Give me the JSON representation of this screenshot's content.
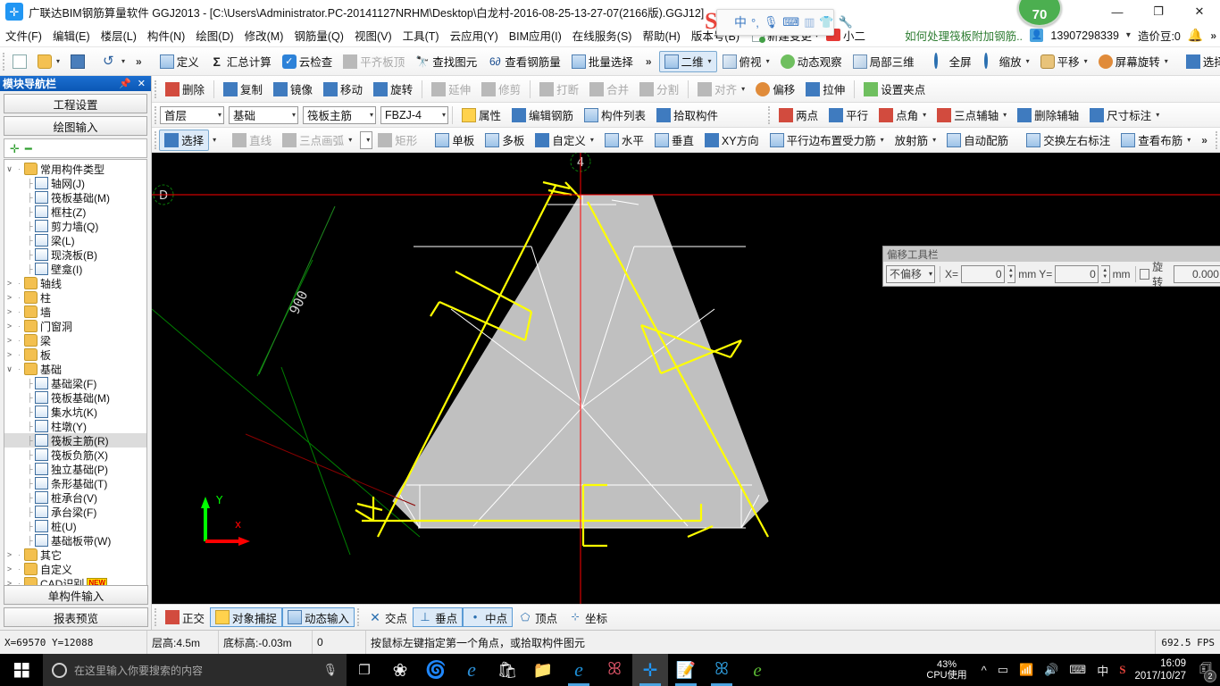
{
  "window": {
    "title": "广联达BIM钢筋算量软件 GGJ2013 - [C:\\Users\\Administrator.PC-20141127NRHM\\Desktop\\白龙村-2016-08-25-13-27-07(2166版).GGJ12]",
    "app_icon": "bim-app-icon",
    "minimize": "—",
    "maximize": "❐",
    "close": "✕",
    "score_badge": "70"
  },
  "menubar": {
    "items": [
      {
        "label": "文件(F)"
      },
      {
        "label": "编辑(E)"
      },
      {
        "label": "楼层(L)"
      },
      {
        "label": "构件(N)"
      },
      {
        "label": "绘图(D)"
      },
      {
        "label": "修改(M)"
      },
      {
        "label": "钢筋量(Q)"
      },
      {
        "label": "视图(V)"
      },
      {
        "label": "工具(T)"
      },
      {
        "label": "云应用(Y)"
      },
      {
        "label": "BIM应用(I)"
      },
      {
        "label": "在线服务(S)"
      },
      {
        "label": "帮助(H)"
      },
      {
        "label": "版本号(B)"
      }
    ],
    "new_change": "新建变更",
    "cart_label": "小二",
    "tip_link": "如何处理筏板附加钢筋..",
    "account": "13907298339",
    "coin_label": "造价豆:0",
    "overflow": "»"
  },
  "ime": {
    "logo": "S",
    "mode": "中",
    "items": [
      "中",
      "°,",
      "mic-icon",
      "keyboard-icon",
      "id-card-icon",
      "skin-icon",
      "wrench-icon"
    ]
  },
  "toolbar1": {
    "quick": [
      {
        "name": "new-file",
        "label": ""
      },
      {
        "name": "open-file",
        "label": ""
      },
      {
        "name": "save-file",
        "label": ""
      },
      {
        "name": "undo",
        "label": ""
      }
    ],
    "overflow1": "»",
    "items": [
      {
        "label": "定义",
        "icon": "define-icon",
        "disabled": false
      },
      {
        "label": "汇总计算",
        "icon": "sigma-icon",
        "disabled": false
      },
      {
        "label": "云检查",
        "icon": "cloud-check-icon",
        "disabled": false
      },
      {
        "label": "平齐板顶",
        "icon": "align-slab-top-icon",
        "disabled": true
      },
      {
        "label": "查找图元",
        "icon": "find-element-icon",
        "disabled": false
      },
      {
        "label": "查看钢筋量",
        "icon": "view-rebar-qty-icon",
        "disabled": false
      },
      {
        "label": "批量选择",
        "icon": "batch-select-icon",
        "disabled": false
      }
    ],
    "overflow2": "»",
    "view_items": [
      {
        "label": "二维",
        "icon": "2d-icon",
        "dropdown": true,
        "selected": true
      },
      {
        "label": "俯视",
        "icon": "top-view-icon",
        "dropdown": true
      },
      {
        "label": "动态观察",
        "icon": "orbit-icon"
      },
      {
        "label": "局部三维",
        "icon": "local-3d-icon"
      },
      {
        "label": "全屏",
        "icon": "fullscreen-icon"
      },
      {
        "label": "缩放",
        "icon": "zoom-icon",
        "dropdown": true
      },
      {
        "label": "平移",
        "icon": "pan-icon",
        "dropdown": true
      },
      {
        "label": "屏幕旋转",
        "icon": "screen-rotate-icon",
        "dropdown": true
      },
      {
        "label": "选择楼层",
        "icon": "select-floor-icon"
      }
    ],
    "overflow3": "»"
  },
  "toolbar2": {
    "items": [
      {
        "label": "删除",
        "icon": "delete-icon",
        "disabled": false
      },
      {
        "label": "复制",
        "icon": "copy-icon",
        "disabled": false
      },
      {
        "label": "镜像",
        "icon": "mirror-icon",
        "disabled": false
      },
      {
        "label": "移动",
        "icon": "move-icon",
        "disabled": false
      },
      {
        "label": "旋转",
        "icon": "rotate-icon",
        "disabled": false
      },
      {
        "label": "延伸",
        "icon": "extend-icon",
        "disabled": true
      },
      {
        "label": "修剪",
        "icon": "trim-icon",
        "disabled": true
      },
      {
        "label": "打断",
        "icon": "break-icon",
        "disabled": true
      },
      {
        "label": "合并",
        "icon": "merge-icon",
        "disabled": true
      },
      {
        "label": "分割",
        "icon": "split-icon",
        "disabled": true
      },
      {
        "label": "对齐",
        "icon": "align-icon",
        "disabled": true,
        "dropdown": true
      },
      {
        "label": "偏移",
        "icon": "offset-icon",
        "disabled": false
      },
      {
        "label": "拉伸",
        "icon": "stretch-icon",
        "disabled": false
      },
      {
        "label": "设置夹点",
        "icon": "set-grip-icon",
        "disabled": false
      }
    ]
  },
  "toolbar3": {
    "floor": "首层",
    "category": "基础",
    "component_type": "筏板主筋",
    "component_name": "FBZJ-4",
    "actions": [
      {
        "label": "属性",
        "icon": "property-icon"
      },
      {
        "label": "编辑钢筋",
        "icon": "edit-rebar-icon"
      },
      {
        "label": "构件列表",
        "icon": "component-list-icon"
      },
      {
        "label": "拾取构件",
        "icon": "pick-component-icon"
      }
    ],
    "axis_tools": [
      {
        "label": "两点",
        "icon": "two-point-icon"
      },
      {
        "label": "平行",
        "icon": "parallel-icon"
      },
      {
        "label": "点角",
        "icon": "point-angle-icon",
        "dropdown": true
      },
      {
        "label": "三点辅轴",
        "icon": "three-point-aux-axis-icon",
        "dropdown": true
      },
      {
        "label": "删除辅轴",
        "icon": "delete-aux-axis-icon"
      },
      {
        "label": "尺寸标注",
        "icon": "dimension-icon",
        "dropdown": true
      }
    ]
  },
  "toolbar4": {
    "items": [
      {
        "label": "选择",
        "icon": "select-arrow-icon",
        "selected": true,
        "dropdown": true
      },
      {
        "label": "直线",
        "icon": "line-icon",
        "disabled": true
      },
      {
        "label": "三点画弧",
        "icon": "three-point-arc-icon",
        "disabled": true,
        "dropdown": true
      },
      {
        "label": "",
        "icon": "empty-combo",
        "combo": true
      },
      {
        "label": "矩形",
        "icon": "rectangle-icon",
        "disabled": true
      },
      {
        "label": "单板",
        "icon": "single-slab-icon"
      },
      {
        "label": "多板",
        "icon": "multi-slab-icon"
      },
      {
        "label": "自定义",
        "icon": "custom-icon",
        "dropdown": true
      },
      {
        "label": "水平",
        "icon": "horizontal-icon"
      },
      {
        "label": "垂直",
        "icon": "vertical-icon"
      },
      {
        "label": "XY方向",
        "icon": "xy-direction-icon"
      },
      {
        "label": "平行边布置受力筋",
        "icon": "parallel-edge-rebar-icon",
        "dropdown": true
      },
      {
        "label": "放射筋",
        "icon": "radial-rebar-icon",
        "dropdown": true
      },
      {
        "label": "自动配筋",
        "icon": "auto-rebar-icon"
      },
      {
        "label": "交换左右标注",
        "icon": "swap-lr-annotation-icon"
      },
      {
        "label": "查看布筋",
        "icon": "view-rebar-layout-icon",
        "dropdown": true
      }
    ],
    "overflow": "»"
  },
  "sidebar": {
    "caption": "模块导航栏",
    "pin_icon": "pin-icon",
    "close_icon": "close-icon",
    "top_buttons": [
      {
        "label": "工程设置"
      },
      {
        "label": "绘图输入"
      }
    ],
    "tree_toolbar": {
      "expand": "expand-all-icon",
      "collapse": "collapse-all-icon"
    },
    "tree": [
      {
        "label": "常用构件类型",
        "type": "folder",
        "expanded": true,
        "depth": 0
      },
      {
        "label": "轴网(J)",
        "type": "leaf",
        "depth": 1
      },
      {
        "label": "筏板基础(M)",
        "type": "leaf",
        "depth": 1
      },
      {
        "label": "框柱(Z)",
        "type": "leaf",
        "depth": 1
      },
      {
        "label": "剪力墙(Q)",
        "type": "leaf",
        "depth": 1
      },
      {
        "label": "梁(L)",
        "type": "leaf",
        "depth": 1
      },
      {
        "label": "现浇板(B)",
        "type": "leaf",
        "depth": 1
      },
      {
        "label": "壁龛(I)",
        "type": "leaf",
        "depth": 1
      },
      {
        "label": "轴线",
        "type": "folder",
        "expanded": false,
        "depth": 0
      },
      {
        "label": "柱",
        "type": "folder",
        "expanded": false,
        "depth": 0
      },
      {
        "label": "墙",
        "type": "folder",
        "expanded": false,
        "depth": 0
      },
      {
        "label": "门窗洞",
        "type": "folder",
        "expanded": false,
        "depth": 0
      },
      {
        "label": "梁",
        "type": "folder",
        "expanded": false,
        "depth": 0
      },
      {
        "label": "板",
        "type": "folder",
        "expanded": false,
        "depth": 0
      },
      {
        "label": "基础",
        "type": "folder",
        "expanded": true,
        "depth": 0
      },
      {
        "label": "基础梁(F)",
        "type": "leaf",
        "depth": 1
      },
      {
        "label": "筏板基础(M)",
        "type": "leaf",
        "depth": 1
      },
      {
        "label": "集水坑(K)",
        "type": "leaf",
        "depth": 1
      },
      {
        "label": "柱墩(Y)",
        "type": "leaf",
        "depth": 1
      },
      {
        "label": "筏板主筋(R)",
        "type": "leaf",
        "depth": 1,
        "selected": true
      },
      {
        "label": "筏板负筋(X)",
        "type": "leaf",
        "depth": 1
      },
      {
        "label": "独立基础(P)",
        "type": "leaf",
        "depth": 1
      },
      {
        "label": "条形基础(T)",
        "type": "leaf",
        "depth": 1
      },
      {
        "label": "桩承台(V)",
        "type": "leaf",
        "depth": 1
      },
      {
        "label": "承台梁(F)",
        "type": "leaf",
        "depth": 1
      },
      {
        "label": "桩(U)",
        "type": "leaf",
        "depth": 1
      },
      {
        "label": "基础板带(W)",
        "type": "leaf",
        "depth": 1
      },
      {
        "label": "其它",
        "type": "folder",
        "expanded": false,
        "depth": 0
      },
      {
        "label": "自定义",
        "type": "folder",
        "expanded": false,
        "depth": 0
      },
      {
        "label": "CAD识别",
        "type": "folder",
        "expanded": false,
        "depth": 0,
        "badge": "NEW"
      }
    ],
    "bottom_buttons": [
      {
        "label": "单构件输入"
      },
      {
        "label": "报表预览"
      }
    ]
  },
  "offset_toolbar": {
    "title": "偏移工具栏",
    "mode": "不偏移",
    "x_label": "X=",
    "x_value": "0",
    "x_unit": "mm",
    "y_label": "Y=",
    "y_value": "0",
    "y_unit": "mm",
    "rotate_label": "旋转",
    "rotate_value": "0.000",
    "rotate_checked": false
  },
  "snapbar": {
    "items": [
      {
        "label": "正交",
        "icon": "ortho-icon",
        "on": false
      },
      {
        "label": "对象捕捉",
        "icon": "object-snap-icon",
        "on": true
      },
      {
        "label": "动态输入",
        "icon": "dynamic-input-icon",
        "on": true
      },
      {
        "label": "交点",
        "icon": "intersection-icon",
        "on": false
      },
      {
        "label": "垂点",
        "icon": "perpendicular-icon",
        "on": true
      },
      {
        "label": "中点",
        "icon": "midpoint-icon",
        "on": true
      },
      {
        "label": "顶点",
        "icon": "vertex-icon",
        "on": false
      },
      {
        "label": "坐标",
        "icon": "coordinate-icon",
        "on": false
      }
    ]
  },
  "statusbar": {
    "coords": "X=69570  Y=12088",
    "floor_height": "层高:4.5m",
    "base_elevation": "底标高:-0.03m",
    "zero": "0",
    "hint": "按鼠标左键指定第一个角点，或拾取构件图元",
    "fps": "692.5 FPS"
  },
  "canvas": {
    "axis_label_d": "D",
    "axis_label_4": "4",
    "dimension_900": "900",
    "axis_x": "x",
    "axis_y": "Y",
    "colors": {
      "background": "#000000",
      "slab_fill": "#c0c0c0",
      "rebar": "#ffff00",
      "grid_axis": "#008000",
      "crosshair": "#ff0000",
      "slab_edge": "#ffffff"
    }
  },
  "taskbar": {
    "start_icon": "windows-start-icon",
    "search_placeholder": "在这里输入你要搜索的内容",
    "cortana_icon": "cortana-icon",
    "mic_icon": "microphone-icon",
    "task_view_icon": "task-view-icon",
    "pinned": [
      {
        "name": "fan-app-icon",
        "glyph": "❀",
        "color": "#f2f2f2"
      },
      {
        "name": "spiral-app-icon",
        "glyph": "🌀",
        "color": "#e8e8e8"
      },
      {
        "name": "edge-browser-icon",
        "glyph": "e",
        "color": "#2c8fd6"
      },
      {
        "name": "microsoft-store-icon",
        "glyph": "▦",
        "color": "#ffffff"
      },
      {
        "name": "file-explorer-icon",
        "glyph": "📁",
        "color": "#f5c14b"
      },
      {
        "name": "internet-explorer-icon",
        "glyph": "e",
        "color": "#1e8fd5"
      },
      {
        "name": "sogou-browser-icon",
        "glyph": "G",
        "color": "#e0566a"
      },
      {
        "name": "ggj-app-icon",
        "glyph": "✛",
        "color": "#2196f3",
        "active": true
      },
      {
        "name": "notepad-app-icon",
        "glyph": "▤",
        "color": "#f5b942"
      },
      {
        "name": "browser-g-icon",
        "glyph": "G",
        "color": "#2f9fe0"
      },
      {
        "name": "green-e-icon",
        "glyph": "e",
        "color": "#5ab734"
      }
    ],
    "cpu_percent": "43%",
    "cpu_label": "CPU使用",
    "tray": [
      {
        "name": "show-hidden-icons",
        "glyph": "^"
      },
      {
        "name": "battery-icon",
        "glyph": "▭"
      },
      {
        "name": "network-icon",
        "glyph": "📶"
      },
      {
        "name": "volume-icon",
        "glyph": "🔊"
      },
      {
        "name": "keyboard-icon",
        "glyph": "⌨"
      },
      {
        "name": "ime-mode-icon",
        "glyph": "中"
      },
      {
        "name": "sogou-tray-icon",
        "glyph": "S"
      }
    ],
    "time": "16:09",
    "date": "2017/10/27",
    "notification_count": "2"
  }
}
